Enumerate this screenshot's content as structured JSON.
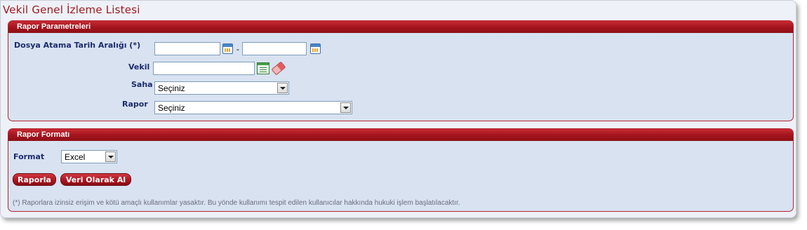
{
  "page": {
    "title": "Vekil Genel İzleme Listesi"
  },
  "params": {
    "header": "Rapor Parametreleri",
    "date_range_label": "Dosya Atama Tarih Aralığı (*)",
    "date_start_value": "",
    "date_separator": "-",
    "date_end_value": "",
    "vekil_label": "Vekil",
    "vekil_value": "",
    "saha_label": "Saha",
    "saha_selected": "Seçiniz",
    "rapor_label": "Rapor",
    "rapor_selected": "Seçiniz"
  },
  "format": {
    "header": "Rapor Formatı",
    "format_label": "Format",
    "format_selected": "Excel",
    "raporla_button": "Raporla",
    "veri_button": "Veri Olarak Al",
    "footnote": "(*) Raporlara izinsiz erişim ve kötü amaçlı kullanımlar yasaktır. Bu yönde kullanımı tespit edilen kullanıcılar hakkında hukuki işlem başlatılacaktır."
  },
  "icons": {
    "calendar": "calendar-icon",
    "list": "list-select-icon",
    "eraser": "eraser-icon"
  },
  "colors": {
    "accent": "#a2141d",
    "panel_bg": "#d8e2f1",
    "label_text": "#1c2b6b"
  }
}
